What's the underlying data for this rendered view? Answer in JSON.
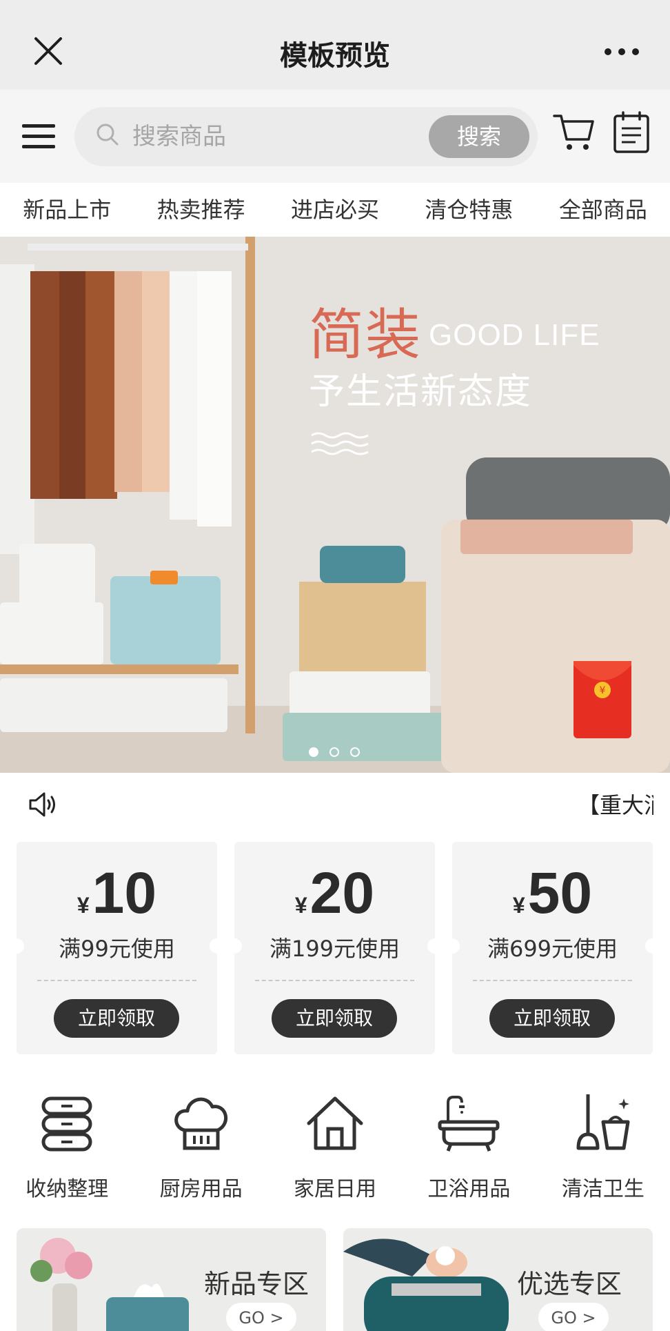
{
  "titlebar": {
    "title": "模板预览"
  },
  "search": {
    "placeholder": "搜索商品",
    "button_label": "搜索"
  },
  "tabs": [
    "新品上市",
    "热卖推荐",
    "进店必买",
    "清仓特惠",
    "全部商品"
  ],
  "banner": {
    "headline": "简装",
    "headline_en": "GOOD LIFE",
    "subline": "予生活新态度",
    "slide_count": 3,
    "active_slide": 1
  },
  "notice": {
    "text": "【重大消"
  },
  "coupons": [
    {
      "currency": "¥",
      "amount": "10",
      "condition": "满99元使用",
      "button": "立即领取"
    },
    {
      "currency": "¥",
      "amount": "20",
      "condition": "满199元使用",
      "button": "立即领取"
    },
    {
      "currency": "¥",
      "amount": "50",
      "condition": "满699元使用",
      "button": "立即领取"
    }
  ],
  "categories": [
    {
      "label": "收纳整理",
      "icon": "storage-icon"
    },
    {
      "label": "厨房用品",
      "icon": "chef-hat-icon"
    },
    {
      "label": "家居日用",
      "icon": "house-icon"
    },
    {
      "label": "卫浴用品",
      "icon": "bathtub-icon"
    },
    {
      "label": "清洁卫生",
      "icon": "mop-bucket-icon"
    }
  ],
  "zones": [
    {
      "title": "新品专区",
      "go": "GO >"
    },
    {
      "title": "优选专区",
      "go": "GO >"
    }
  ],
  "colors": {
    "accent_red": "#d86a55",
    "button_dark": "#333333",
    "search_button": "#a8a8a8"
  }
}
